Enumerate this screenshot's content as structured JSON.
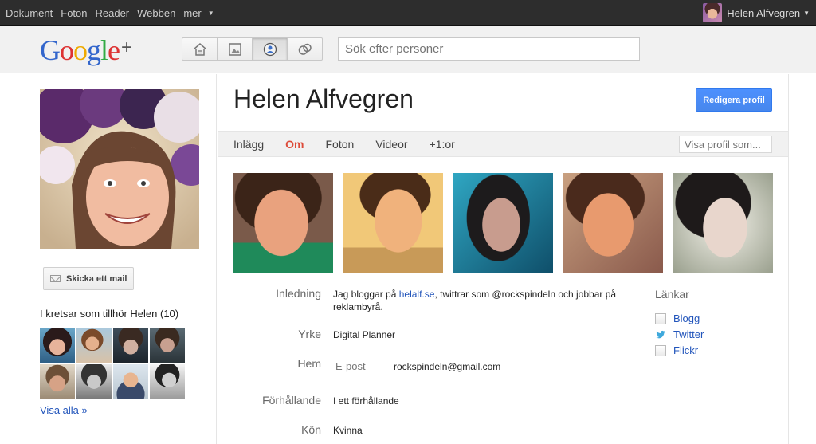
{
  "topbar": {
    "nav": [
      "Dokument",
      "Foton",
      "Reader",
      "Webben",
      "mer"
    ],
    "user_name": "Helen Alfvegren"
  },
  "header": {
    "logo": {
      "g1": "G",
      "o1": "o",
      "o2": "o",
      "g2": "g",
      "l": "l",
      "e": "e",
      "plus": "+"
    },
    "search_placeholder": "Sök efter personer",
    "modes": [
      "home-icon",
      "photos-icon",
      "profile-icon",
      "circles-icon"
    ]
  },
  "left": {
    "mail_button": "Skicka ett mail",
    "circles_title": "I kretsar som tillhör Helen (10)",
    "see_all": "Visa alla »"
  },
  "profile": {
    "name": "Helen Alfvegren",
    "edit_button": "Redigera profil",
    "tabs": [
      "Inlägg",
      "Om",
      "Foton",
      "Videor",
      "+1:or"
    ],
    "active_tab": "Om",
    "view_as_placeholder": "Visa profil som..."
  },
  "about": {
    "intro_label": "Inledning",
    "intro_pre": "Jag bloggar på ",
    "intro_link": "helalf.se",
    "intro_post": ", twittrar som @rockspindeln och jobbar på reklambyrå.",
    "job_label": "Yrke",
    "job_value": "Digital Planner",
    "home_label": "Hem",
    "email_label": "E-post",
    "email_value": "rockspindeln@gmail.com",
    "relation_label": "Förhållande",
    "relation_value": "I ett förhållande",
    "gender_label": "Kön",
    "gender_value": "Kvinna"
  },
  "links": {
    "title": "Länkar",
    "items": [
      "Blogg",
      "Twitter",
      "Flickr"
    ]
  },
  "colors": {
    "accent_blue": "#4d90fe",
    "active_tab_red": "#dd4b39",
    "link_blue": "#2255bb"
  }
}
